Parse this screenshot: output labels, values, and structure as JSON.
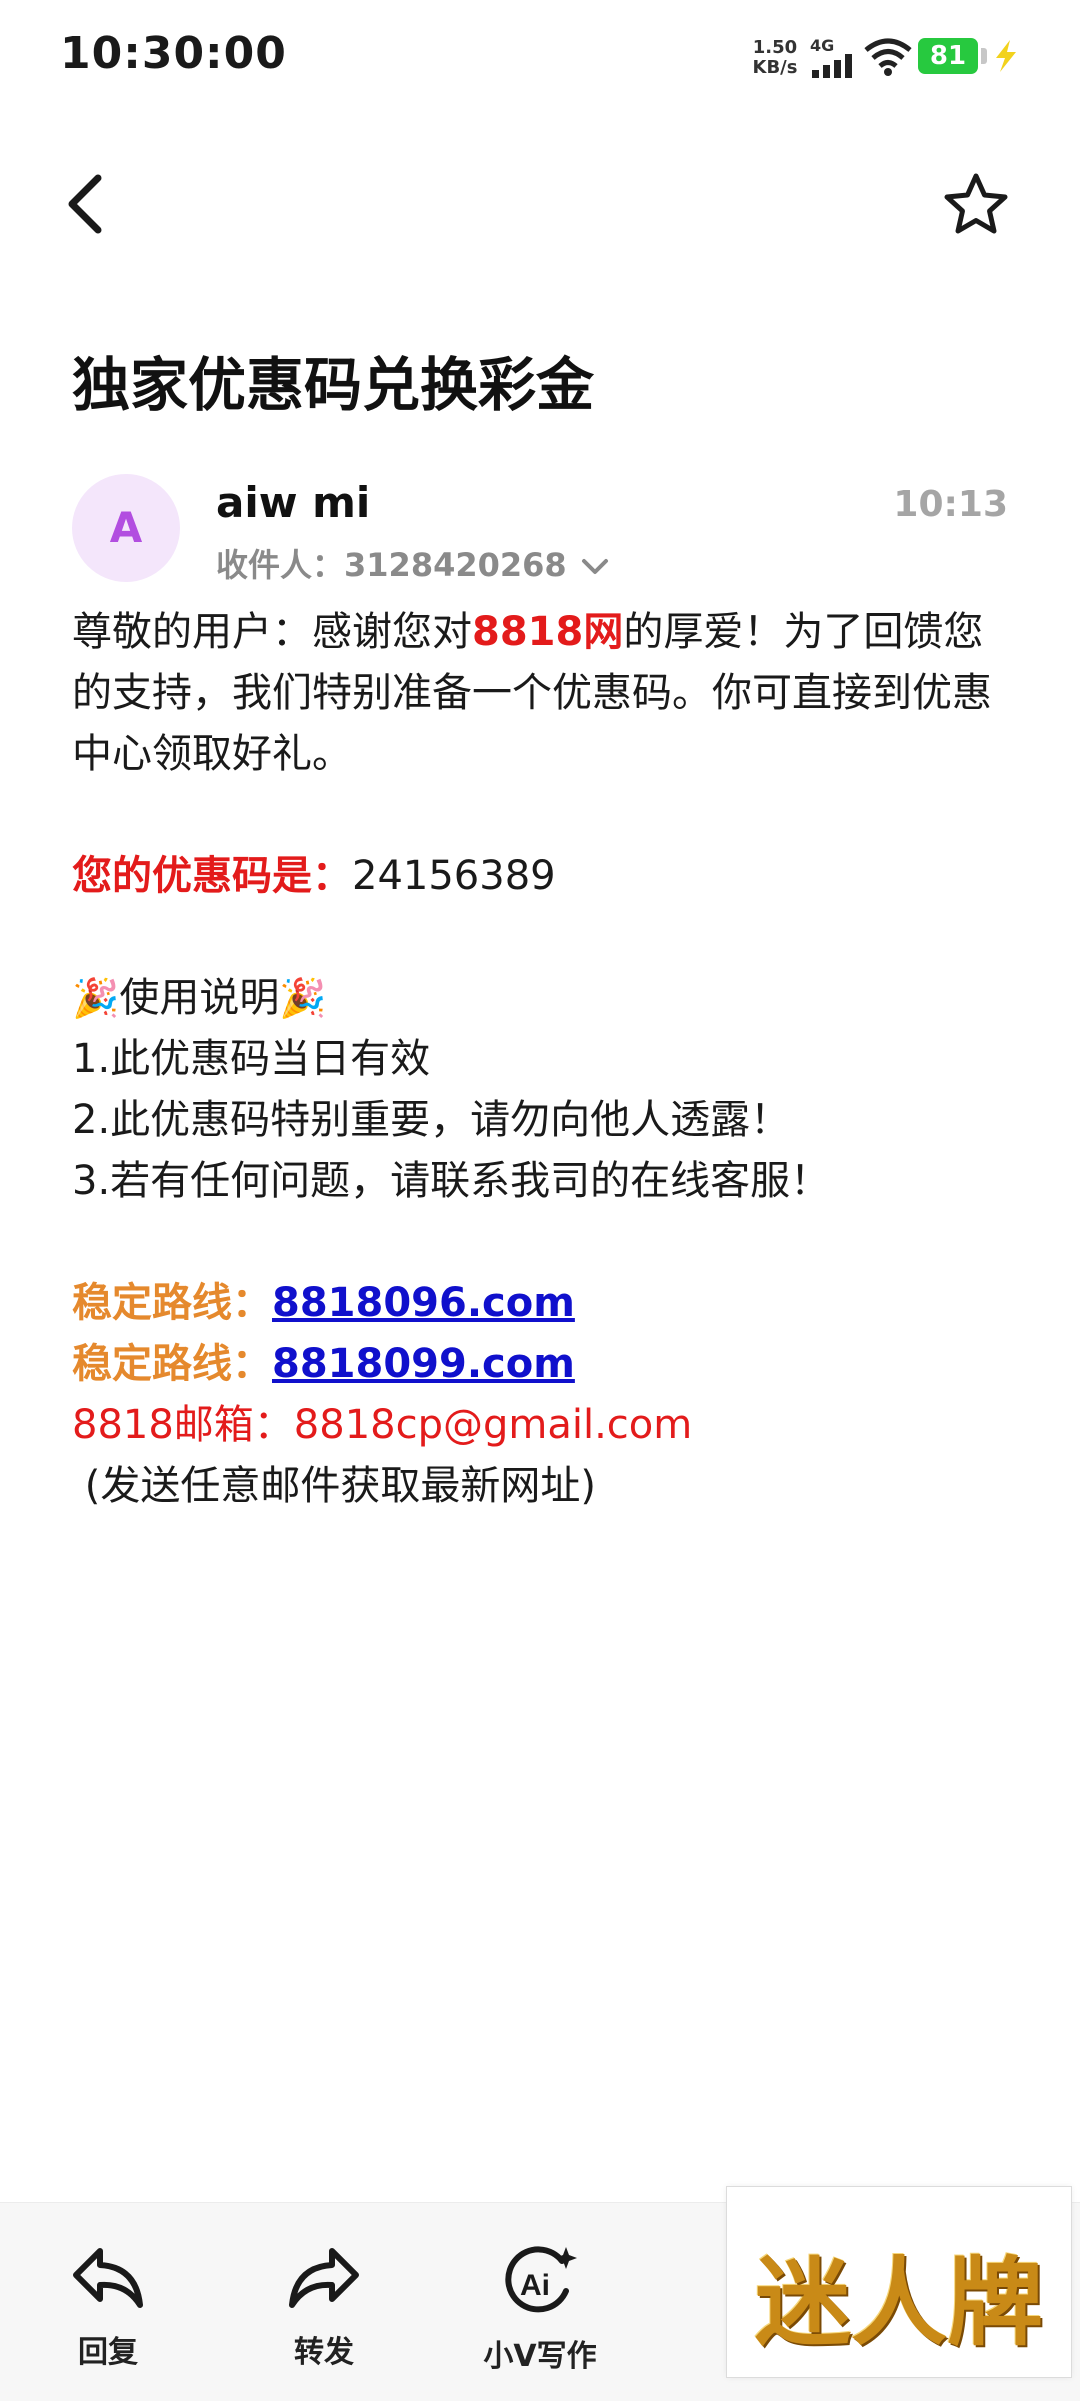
{
  "status_bar": {
    "time": "10:30:00",
    "net_speed_value": "1.50",
    "net_speed_unit": "KB/s",
    "network_type": "4G",
    "battery_level": "81",
    "battery_color": "#27c93f",
    "charge_color": "#f2d21c"
  },
  "header": {
    "back_icon": "chevron-left-icon",
    "star_icon": "star-outline-icon"
  },
  "email": {
    "subject": "独家优惠码兑换彩金",
    "sender_initial": "A",
    "sender_name": "aiw mi",
    "time": "10:13",
    "recipient_label": "收件人：",
    "recipient": "3128420268",
    "body": {
      "p1_a": "尊敬的用户：感谢您对",
      "p1_brand": "8818网",
      "p1_b": "的厚爱！为了回馈您的支持，我们特别准备一个优惠码。你可直接到优惠中心领取好礼。",
      "code_label": "您的优惠码是：",
      "code_value": "24156389",
      "usage_emoji": "🎉",
      "usage_title": "使用说明",
      "rule1": "1.此优惠码当日有效",
      "rule2": "2.此优惠码特别重要，请勿向他人透露！",
      "rule3": "3.若有任何问题，请联系我司的在线客服！",
      "route_label": "稳定路线：",
      "route1": "8818096.com",
      "route2": "8818099.com",
      "mailbox_label": "8818邮箱：",
      "mailbox": "8818cp@gmail.com",
      "note": "(发送任意邮件获取最新网址)"
    }
  },
  "actions": {
    "reply": "回复",
    "forward": "转发",
    "ai_write": "小V写作"
  },
  "watermark": {
    "text": "迷人牌"
  },
  "colors": {
    "accent_red": "#e31b1b",
    "accent_orange": "#e5892d",
    "link_blue": "#1010cc",
    "avatar_bg": "#f4e6fb",
    "avatar_fg": "#b24ee0"
  }
}
